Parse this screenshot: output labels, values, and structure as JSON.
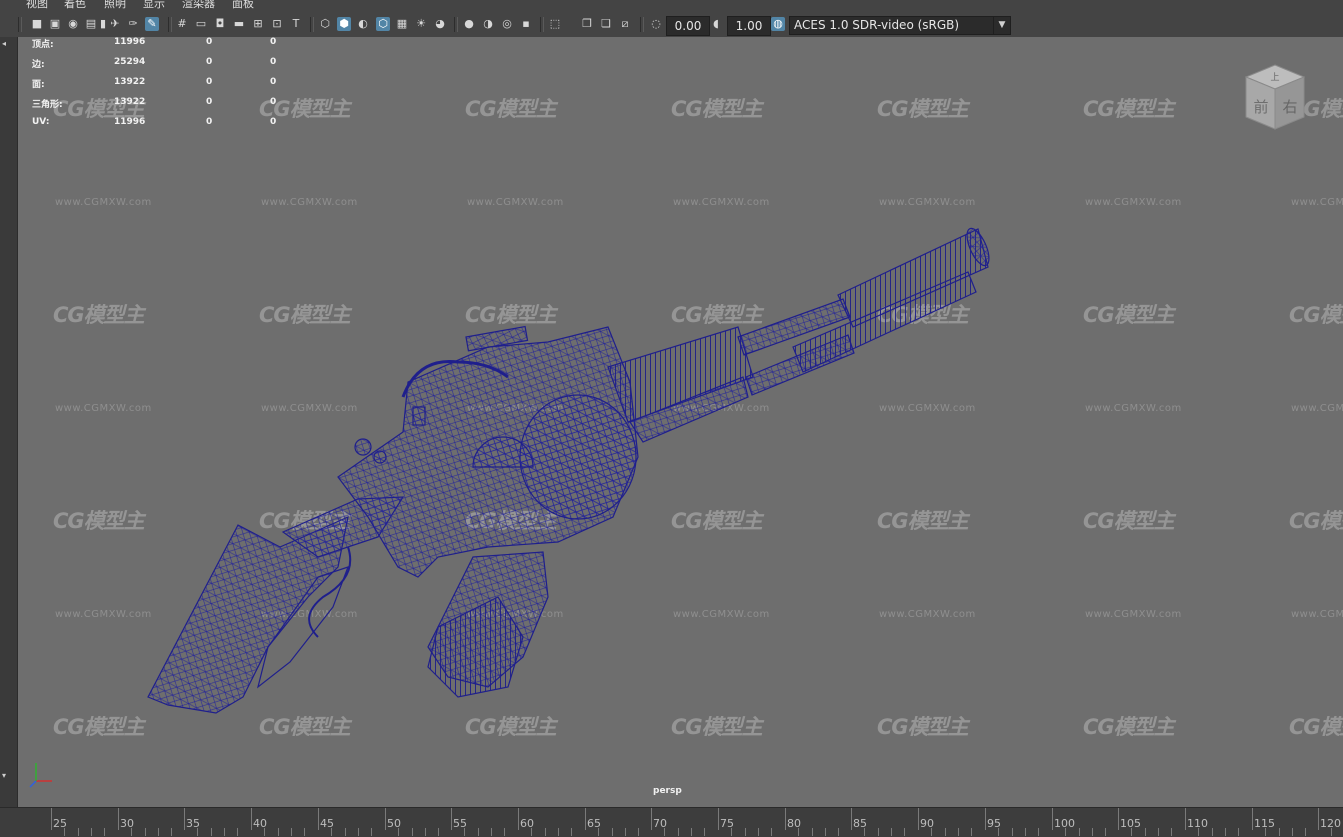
{
  "menu": {
    "items": [
      "视图",
      "着色",
      "照明",
      "显示",
      "渲染器",
      "面板"
    ]
  },
  "toolbar": {
    "exposure_value": "0.00",
    "gamma_value": "1.00",
    "color_space": "ACES 1.0 SDR-video (sRGB)"
  },
  "hud": {
    "rows": [
      {
        "label": "顶点:",
        "v1": "11996",
        "v2": "0",
        "v3": "0"
      },
      {
        "label": "边:",
        "v1": "25294",
        "v2": "0",
        "v3": "0"
      },
      {
        "label": "面:",
        "v1": "13922",
        "v2": "0",
        "v3": "0"
      },
      {
        "label": "三角形:",
        "v1": "13922",
        "v2": "0",
        "v3": "0"
      },
      {
        "label": "UV:",
        "v1": "11996",
        "v2": "0",
        "v3": "0"
      }
    ]
  },
  "viewport": {
    "camera_label": "persp",
    "watermark_logo": "CG模型主",
    "watermark_url": "www.CGMXW.com",
    "viewcube": {
      "top": "上",
      "front": "前",
      "right": "右"
    },
    "wireframe_color": "#1f1f8c",
    "background_color": "#6e6e6e"
  },
  "timeline": {
    "labels": [
      "25",
      "30",
      "35",
      "40",
      "45",
      "50",
      "55",
      "60",
      "65",
      "70",
      "75",
      "80",
      "85",
      "90",
      "95",
      "100",
      "105",
      "110",
      "115",
      "120"
    ]
  }
}
